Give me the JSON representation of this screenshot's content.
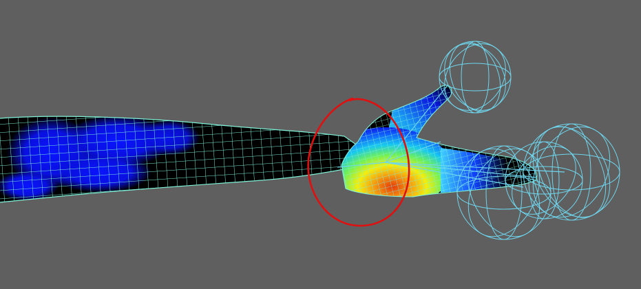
{
  "viewport": {
    "background": "#5f5f5f",
    "wire_color": "#7ff2d8",
    "joint_color": "#6fd6ee",
    "skin_color": "#000000"
  },
  "weight_map": {
    "low": "#0a12f0",
    "mid": "#f2f20a",
    "high": "#e6320a"
  },
  "annotation": {
    "shape": "hand-drawn-circle",
    "color": "#e01010"
  }
}
